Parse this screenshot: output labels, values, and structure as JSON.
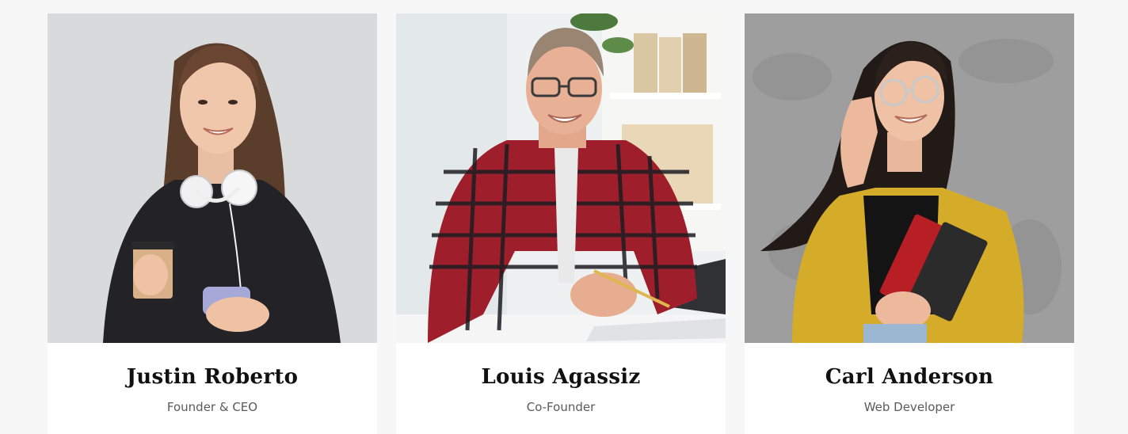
{
  "team": {
    "members": [
      {
        "name": "Justin Roberto",
        "role": "Founder & CEO"
      },
      {
        "name": "Louis Agassiz",
        "role": "Co-Founder"
      },
      {
        "name": "Carl Anderson",
        "role": "Web Developer"
      }
    ]
  }
}
